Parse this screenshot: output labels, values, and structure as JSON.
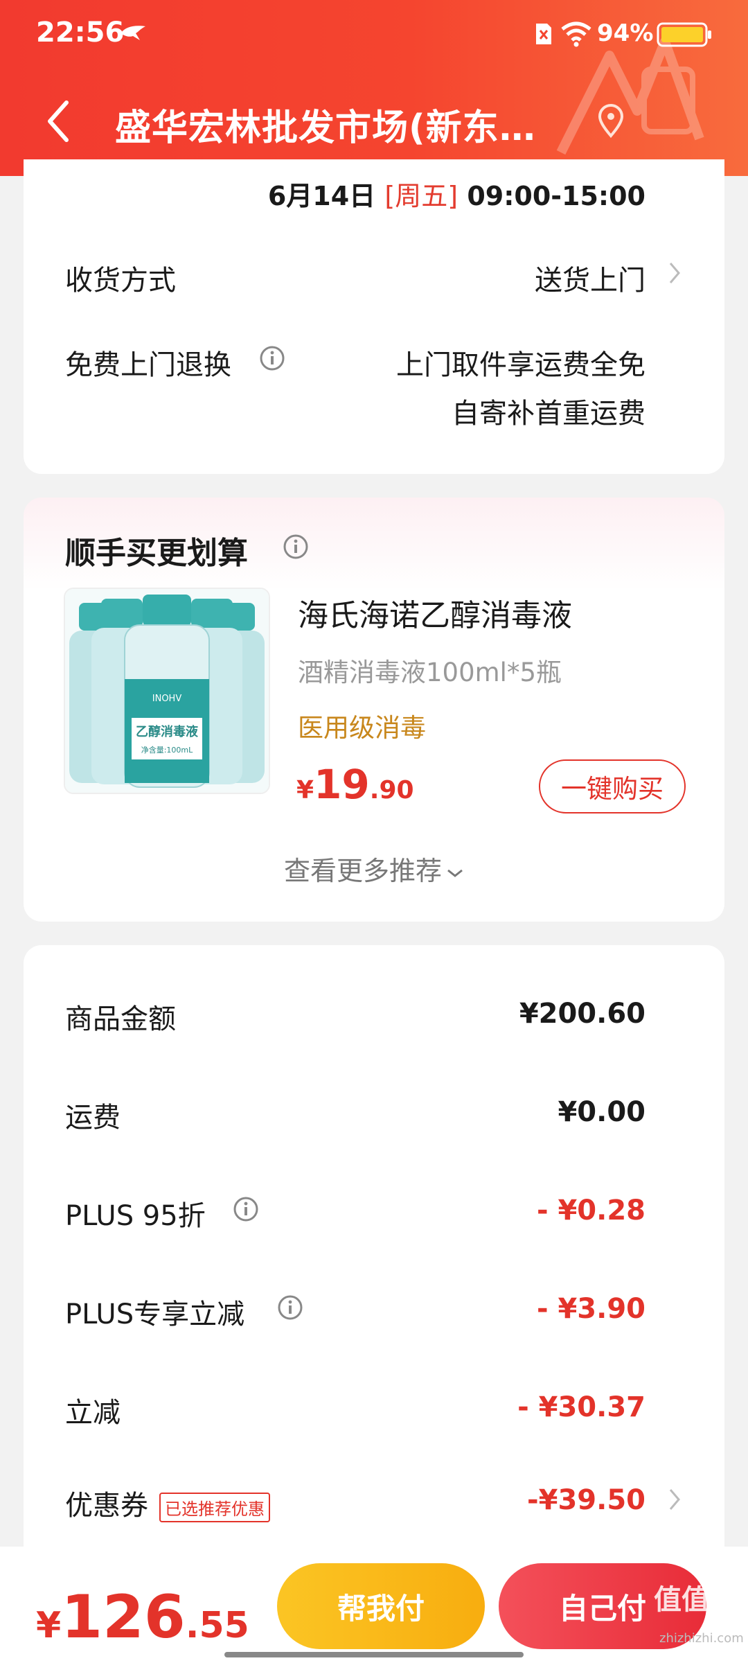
{
  "status_bar": {
    "time": "22:56",
    "battery": "94%"
  },
  "header": {
    "title": "盛华宏林批发市场(新东…"
  },
  "delivery": {
    "date": "6月14日",
    "weekday": "[周五]",
    "time_range": "09:00-15:00"
  },
  "shipping": {
    "method_label": "收货方式",
    "method_value": "送货上门",
    "return_label": "免费上门退换",
    "return_value_1": "上门取件享运费全免",
    "return_value_2": "自寄补首重运费"
  },
  "recommend": {
    "title": "顺手买更划算",
    "product": {
      "name": "海氏海诺乙醇消毒液",
      "spec": "酒精消毒液100ml*5瓶",
      "tag": "医用级消毒",
      "price_symbol": "¥",
      "price_int": "19",
      "price_dec": ".90",
      "buy_label": "一键购买",
      "image_text": "乙醇消毒液",
      "image_volume": "净含量:100mL",
      "image_brand": "INOHV"
    },
    "more_label": "查看更多推荐"
  },
  "summary": {
    "rows": [
      {
        "label": "商品金额",
        "value": "¥200.60"
      },
      {
        "label": "运费",
        "value": "¥0.00"
      },
      {
        "label": "PLUS 95折",
        "value": "- ¥0.28"
      },
      {
        "label": "PLUS专享立减",
        "value": "- ¥3.90"
      },
      {
        "label": "立减",
        "value": "- ¥30.37"
      },
      {
        "label": "优惠券",
        "value": "-¥39.50",
        "tag": "已选推荐优惠"
      }
    ]
  },
  "bottom": {
    "total_symbol": "¥",
    "total_int": "126",
    "total_dec": ".55",
    "help_pay": "帮我付",
    "self_pay": "自己付"
  },
  "watermark": {
    "main": "值值值",
    "sub": "zhizhizhi.com"
  },
  "colors": {
    "accent": "#e3332a",
    "header": "#f23a2f",
    "gold": "#c8871c",
    "yellow": "#fbc524"
  }
}
